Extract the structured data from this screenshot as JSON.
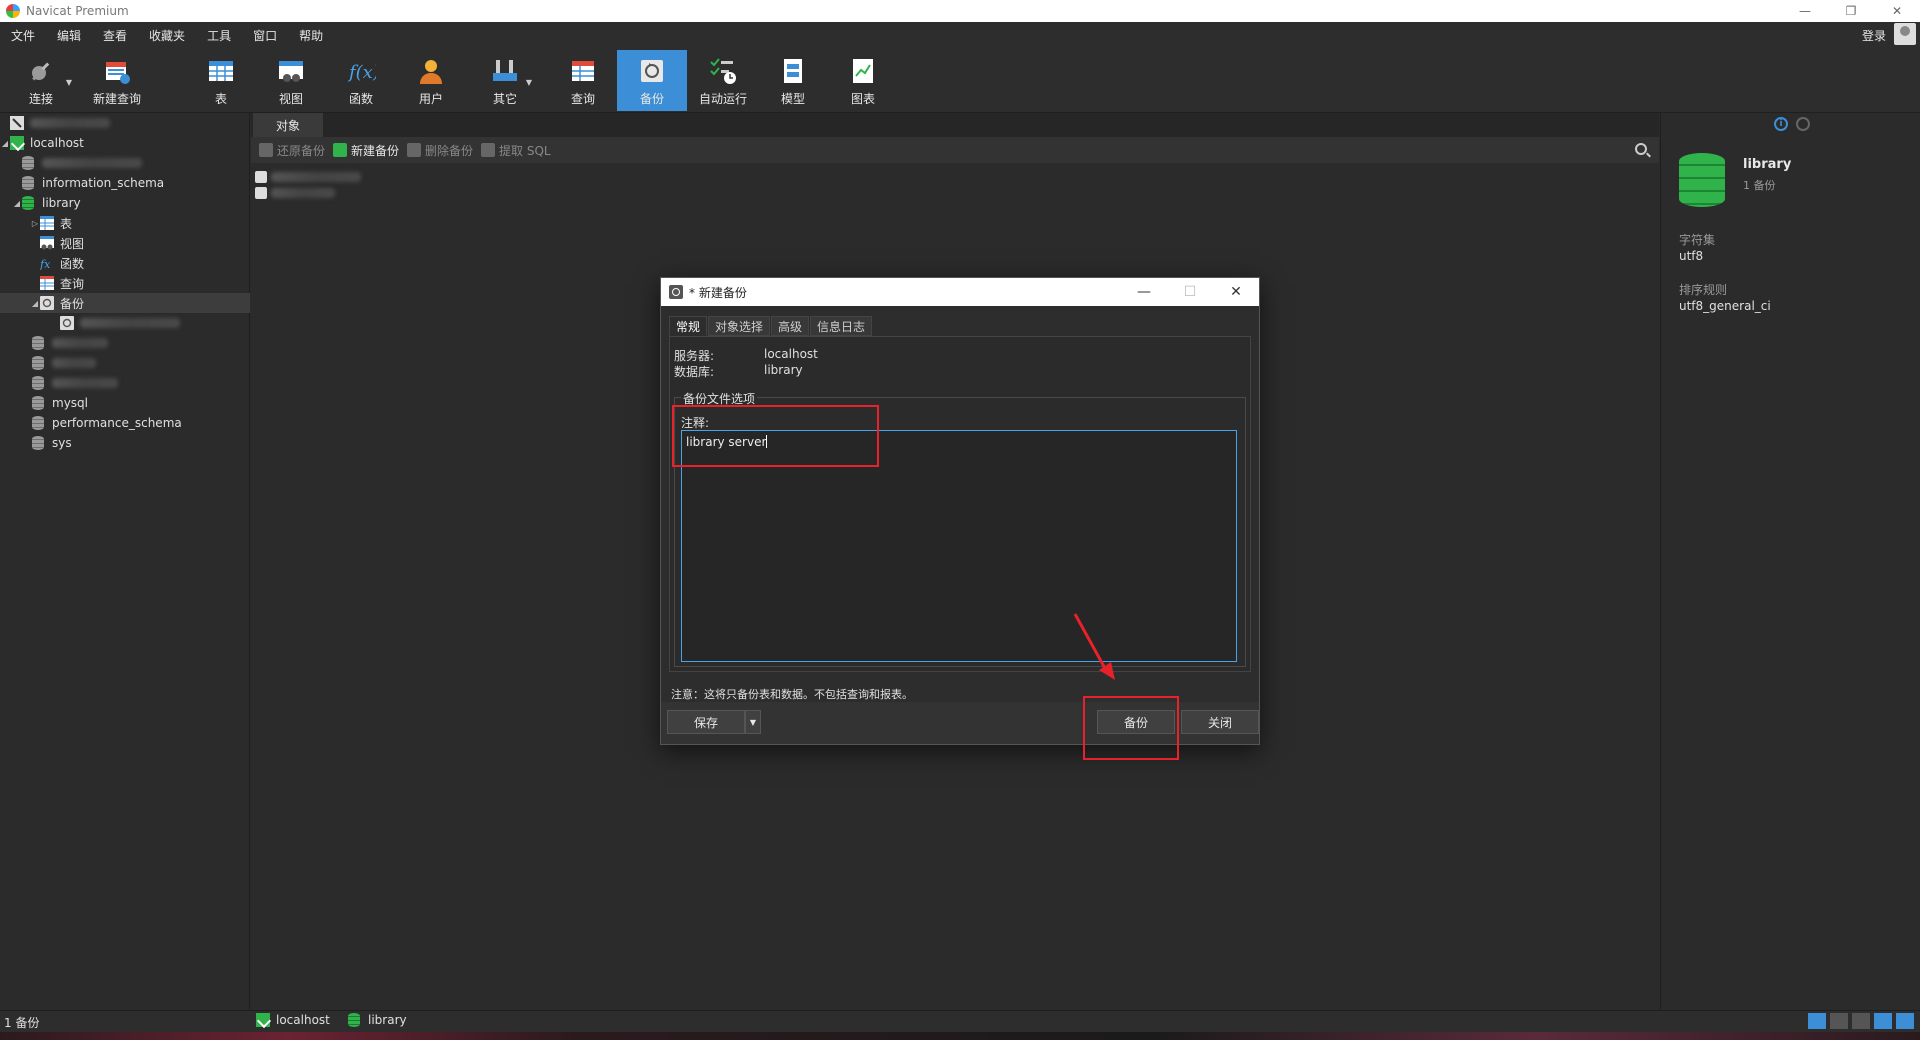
{
  "window": {
    "title": "Navicat Premium"
  },
  "menu": [
    "文件",
    "编辑",
    "查看",
    "收藏夹",
    "工具",
    "窗口",
    "帮助"
  ],
  "login": "登录",
  "toolbar": {
    "connect": "连接",
    "new_query": "新建查询",
    "table": "表",
    "view": "视图",
    "function": "函数",
    "user": "用户",
    "other": "其它",
    "query": "查询",
    "backup": "备份",
    "automation": "自动运行",
    "model": "模型",
    "chart": "图表"
  },
  "tree": {
    "localhost": "localhost",
    "information_schema": "information_schema",
    "library": "library",
    "tables": "表",
    "views": "视图",
    "functions": "函数",
    "queries": "查询",
    "backups": "备份",
    "mysql": "mysql",
    "performance_schema": "performance_schema",
    "sys": "sys"
  },
  "main": {
    "tab_objects": "对象",
    "restore_backup": "还原备份",
    "new_backup": "新建备份",
    "delete_backup": "删除备份",
    "extract_sql": "提取 SQL"
  },
  "info": {
    "name": "library",
    "subtitle": "1 备份",
    "charset_label": "字符集",
    "charset_value": "utf8",
    "collation_label": "排序规则",
    "collation_value": "utf8_general_ci"
  },
  "status": {
    "left": "1 备份",
    "connection": "localhost",
    "database": "library"
  },
  "dialog": {
    "title": "* 新建备份",
    "tabs": [
      "常规",
      "对象选择",
      "高级",
      "信息日志"
    ],
    "server_label": "服务器:",
    "server_value": "localhost",
    "database_label": "数据库:",
    "database_value": "library",
    "options_legend": "备份文件选项",
    "comment_label": "注释:",
    "comment_value": "library server",
    "note": "注意：这将只备份表和数据。不包括查询和报表。",
    "save_button": "保存",
    "backup_button": "备份",
    "close_button": "关闭"
  },
  "colors": {
    "accent": "#3c8fd6",
    "db_green": "#2fb34a",
    "annotation_red": "#e8222a"
  }
}
